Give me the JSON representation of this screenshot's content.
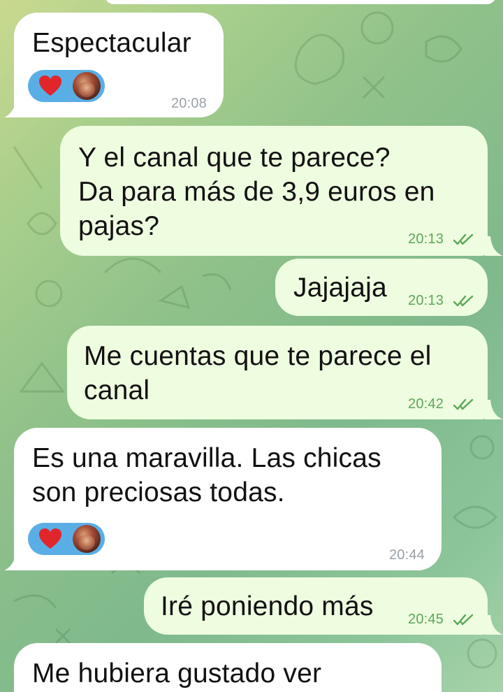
{
  "chat": {
    "messages": [
      {
        "id": "m1",
        "direction": "incoming",
        "lines": [
          "Espectacular"
        ],
        "time": "20:08",
        "reaction": {
          "emoji": "heart-icon",
          "has_avatar": true
        }
      },
      {
        "id": "m2",
        "direction": "outgoing",
        "lines": [
          "Y el canal que te parece?",
          "Da para más de 3,9 euros en",
          "pajas?"
        ],
        "time": "20:13",
        "status": "read"
      },
      {
        "id": "m3",
        "direction": "outgoing",
        "lines": [
          "Jajajaja"
        ],
        "time": "20:13",
        "status": "read"
      },
      {
        "id": "m4",
        "direction": "outgoing",
        "lines": [
          "Me cuentas que te parece el",
          "canal"
        ],
        "time": "20:42",
        "status": "read"
      },
      {
        "id": "m5",
        "direction": "incoming",
        "lines": [
          "Es una maravilla. Las chicas",
          "son preciosas todas."
        ],
        "time": "20:44",
        "reaction": {
          "emoji": "heart-icon",
          "has_avatar": true
        }
      },
      {
        "id": "m6",
        "direction": "outgoing",
        "lines": [
          "Iré poniendo más"
        ],
        "time": "20:45",
        "status": "read"
      },
      {
        "id": "m7",
        "direction": "incoming",
        "lines": [
          "Me hubiera gustado ver"
        ]
      }
    ]
  },
  "colors": {
    "incoming_bubble": "#ffffff",
    "outgoing_bubble": "#eefcdf",
    "outgoing_meta": "#5aa85a",
    "incoming_meta": "#9aa0a6",
    "reaction_bg": "#5aaee6",
    "heart": "#e0262b"
  }
}
